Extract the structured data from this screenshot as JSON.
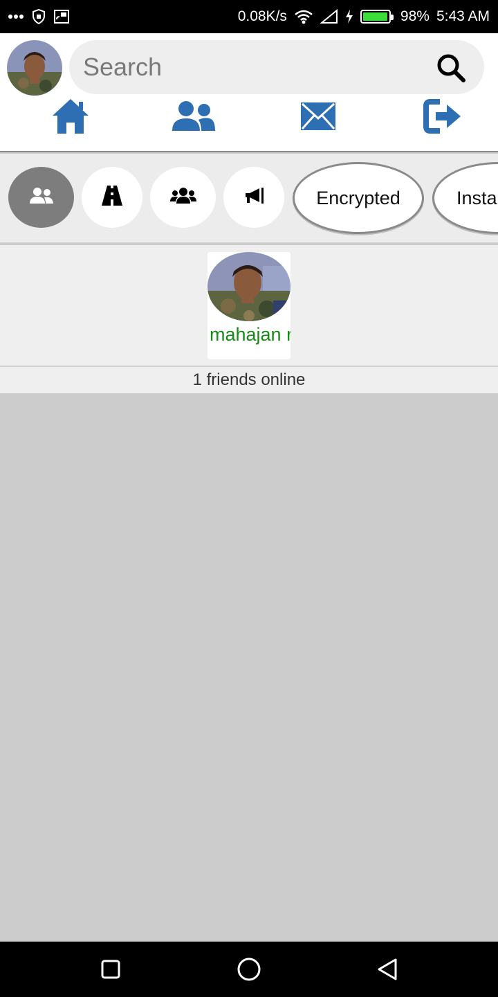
{
  "status_bar": {
    "net_speed": "0.08K/s",
    "battery": "98%",
    "battery_level": 0.98,
    "time": "5:43 AM",
    "battery_color": "#3ddc3d"
  },
  "header": {
    "search_placeholder": "Search",
    "nav": [
      "home-icon",
      "friends-icon",
      "messages-icon",
      "logout-icon"
    ],
    "accent_color": "#2e6fb3"
  },
  "filters": {
    "icon_chips": [
      "friends-icon",
      "road-icon",
      "groups-icon",
      "megaphone-icon"
    ],
    "text_chips": [
      "Encrypted",
      "Insta"
    ]
  },
  "friends": {
    "online": [
      {
        "name": "mahajan r"
      }
    ],
    "online_label": "1 friends online",
    "name_color": "#178a17"
  }
}
